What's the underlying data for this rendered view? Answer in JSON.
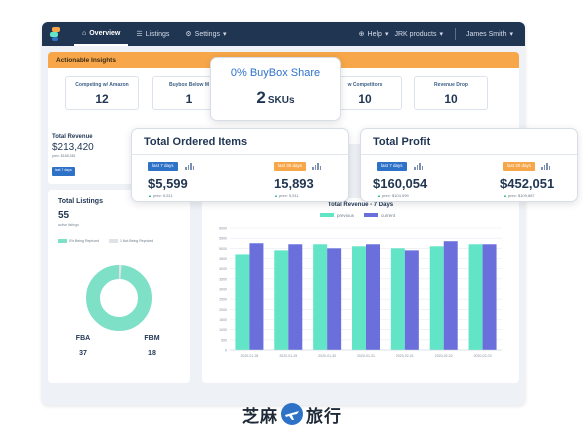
{
  "topbar": {
    "nav": [
      {
        "icon": "home-icon",
        "label": "Overview",
        "active": true
      },
      {
        "icon": "list-icon",
        "label": "Listings",
        "active": false
      },
      {
        "icon": "gear-icon",
        "label": "Settings",
        "active": false
      }
    ],
    "help_label": "Help",
    "account_label": "JRK products",
    "user_label": "James Smith"
  },
  "insights": {
    "title": "Actionable Insights",
    "cards": [
      {
        "label": "Competing w/ Amazon",
        "value": "12"
      },
      {
        "label": "Buybox Below M",
        "value": "1"
      },
      {
        "label": "w Competitors",
        "value": "10"
      },
      {
        "label": "Revenue Drop",
        "value": "10"
      }
    ]
  },
  "buybox_popup": {
    "title": "0% BuyBox Share",
    "value": "2",
    "unit": "SKUs"
  },
  "total_revenue": {
    "title": "Total Revenue",
    "pill": "last 7 days",
    "amount": "$213,420",
    "prev": "prev: $168,345"
  },
  "ordered_items": {
    "title": "Total Ordered Items",
    "left_pill": "last 7 days",
    "left_value": "$5,599",
    "left_prev": "prev: 5,511",
    "right_pill": "last 30 days",
    "right_value": "15,893",
    "right_prev": "prev: 5,511"
  },
  "total_profit": {
    "title": "Total Profit",
    "left_pill": "last 7 days",
    "left_value": "$160,054",
    "left_prev": "prev: $104,099",
    "right_pill": "last 30 days",
    "right_value": "$452,051",
    "right_prev": "prev: $109,887"
  },
  "listings": {
    "title": "Total Listings",
    "count": "55",
    "sub": "active listings",
    "legend": [
      {
        "label": "0% Being Repriced",
        "color": "#7fe0c8"
      },
      {
        "label": "1 Not Being Repriced",
        "color": "#dfe3e8"
      }
    ],
    "fba_label": "FBA",
    "fba_value": "37",
    "fbm_label": "FBM",
    "fbm_value": "18"
  },
  "chart_data": {
    "type": "bar",
    "title": "Total Revenue - 7 Days",
    "series": [
      {
        "name": "previous",
        "color": "#62e4c6",
        "values": [
          4700,
          4900,
          5200,
          5100,
          5000,
          5100,
          5200
        ]
      },
      {
        "name": "current",
        "color": "#6b6fdc",
        "values": [
          5250,
          5200,
          5000,
          5200,
          4900,
          5350,
          5200
        ]
      }
    ],
    "categories": [
      "2020-01-28",
      "2020-01-29",
      "2020-01-30",
      "2020-01-31",
      "2020-02-01",
      "2020-02-02",
      "2020-02-03"
    ],
    "ylim": [
      0,
      6000
    ],
    "yticks": [
      "6000",
      "5500",
      "5000",
      "4500",
      "4000",
      "3500",
      "3000",
      "2500",
      "2000",
      "1500",
      "1000",
      "500",
      "0"
    ],
    "grid": true,
    "legend": "top-center"
  },
  "watermark": {
    "text_left": "芝麻",
    "text_right": "旅行"
  }
}
